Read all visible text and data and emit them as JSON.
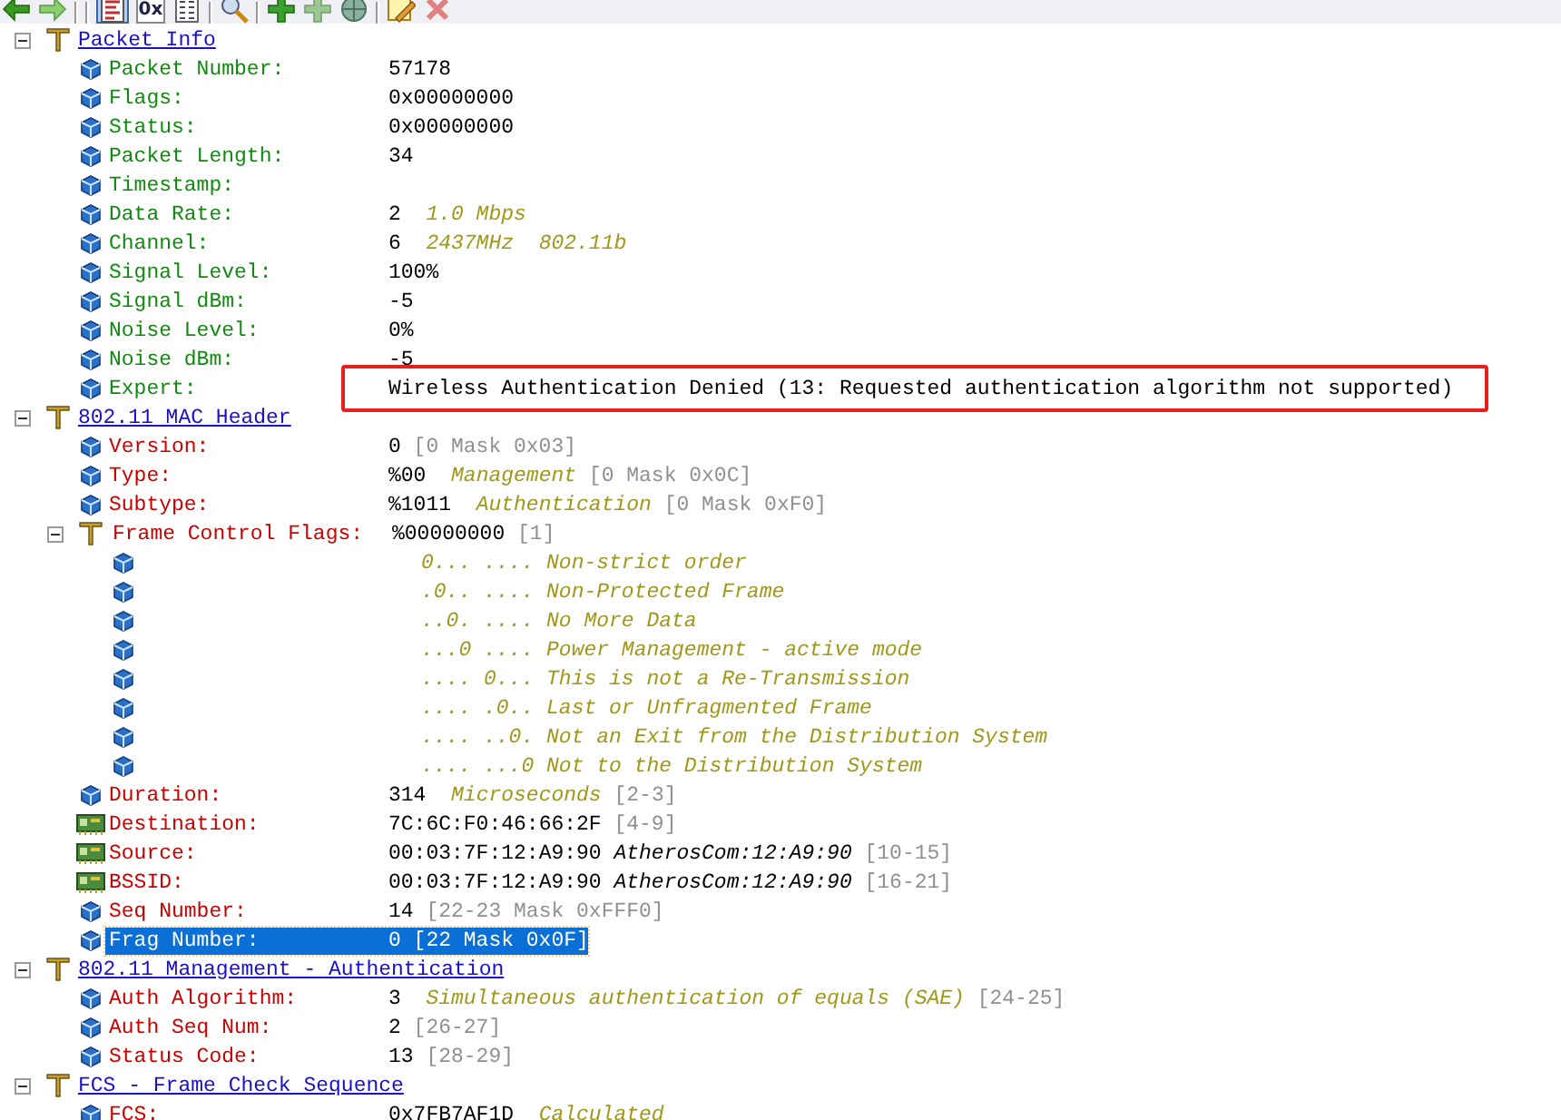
{
  "toolbar": [
    {
      "kind": "back"
    },
    {
      "kind": "forward"
    },
    {
      "kind": "separator"
    },
    {
      "kind": "separator"
    },
    {
      "kind": "decode-view",
      "selected": true
    },
    {
      "kind": "hex-view",
      "label": "0x",
      "selected": false
    },
    {
      "kind": "text-view",
      "selected": false
    },
    {
      "kind": "separator"
    },
    {
      "kind": "search"
    },
    {
      "kind": "separator"
    },
    {
      "kind": "add"
    },
    {
      "kind": "add-disabled"
    },
    {
      "kind": "globe"
    },
    {
      "kind": "separator"
    },
    {
      "kind": "edit"
    },
    {
      "kind": "delete"
    }
  ],
  "sections": [
    {
      "title": "Packet Info",
      "kind": "info",
      "expanded": true,
      "fields": [
        {
          "kind": "cube",
          "label": "Packet Number:",
          "value": "57178",
          "selected": false,
          "boxed": false
        },
        {
          "kind": "cube",
          "label": "Flags:",
          "value": "0x00000000",
          "selected": false,
          "boxed": false
        },
        {
          "kind": "cube",
          "label": "Status:",
          "value": "0x00000000",
          "selected": false,
          "boxed": false
        },
        {
          "kind": "cube",
          "label": "Packet Length:",
          "value": "34",
          "selected": false,
          "boxed": false
        },
        {
          "kind": "cube",
          "label": "Timestamp:",
          "selected": false,
          "boxed": false
        },
        {
          "kind": "cube",
          "label": "Data Rate:",
          "value": "2",
          "note": "1.0 Mbps",
          "selected": false,
          "boxed": false
        },
        {
          "kind": "cube",
          "label": "Channel:",
          "value": "6",
          "note": "2437MHz  802.11b",
          "selected": false,
          "boxed": false
        },
        {
          "kind": "cube",
          "label": "Signal Level:",
          "value": "100%",
          "selected": false,
          "boxed": false
        },
        {
          "kind": "cube",
          "label": "Signal dBm:",
          "value": "-5",
          "selected": false,
          "boxed": false
        },
        {
          "kind": "cube",
          "label": "Noise Level:",
          "value": "0%",
          "selected": false,
          "boxed": false
        },
        {
          "kind": "cube",
          "label": "Noise dBm:",
          "value": "-5",
          "selected": false,
          "boxed": false
        },
        {
          "kind": "cube",
          "label": "Expert:",
          "value": "Wireless Authentication Denied (13: Requested authentication algorithm not supported)",
          "selected": false,
          "boxed": true
        }
      ]
    },
    {
      "title": "802.11 MAC Header",
      "kind": "protocol",
      "expanded": true,
      "fields": [
        {
          "kind": "cube",
          "label": "Version:",
          "value": "0",
          "range": "[0 Mask 0x03]",
          "selected": false,
          "boxed": false
        },
        {
          "kind": "cube",
          "label": "Type:",
          "value": "%00",
          "note": "Management",
          "range": "[0 Mask 0x0C]",
          "selected": false,
          "boxed": false
        },
        {
          "kind": "cube",
          "label": "Subtype:",
          "value": "%1011",
          "note": "Authentication",
          "range": "[0 Mask 0xF0]",
          "selected": false,
          "boxed": false
        },
        {
          "kind": "branch",
          "label": "Frame Control Flags:",
          "value": "%00000000",
          "range": "[1]",
          "selected": false,
          "boxed": false,
          "expanded": true,
          "children": [
            {
              "kind": "cube",
              "note": "0... .... Non-strict order",
              "selected": false,
              "boxed": false
            },
            {
              "kind": "cube",
              "note": ".0.. .... Non-Protected Frame",
              "selected": false,
              "boxed": false
            },
            {
              "kind": "cube",
              "note": "..0. .... No More Data",
              "selected": false,
              "boxed": false
            },
            {
              "kind": "cube",
              "note": "...0 .... Power Management - active mode",
              "selected": false,
              "boxed": false
            },
            {
              "kind": "cube",
              "note": ".... 0... This is not a Re-Transmission",
              "selected": false,
              "boxed": false
            },
            {
              "kind": "cube",
              "note": ".... .0.. Last or Unfragmented Frame",
              "selected": false,
              "boxed": false
            },
            {
              "kind": "cube",
              "note": ".... ..0. Not an Exit from the Distribution System",
              "selected": false,
              "boxed": false
            },
            {
              "kind": "cube",
              "note": ".... ...0 Not to the Distribution System",
              "selected": false,
              "boxed": false
            }
          ]
        },
        {
          "kind": "cube",
          "label": "Duration:",
          "value": "314",
          "note": "Microseconds",
          "range": "[2-3]",
          "selected": false,
          "boxed": false
        },
        {
          "kind": "address",
          "label": "Destination:",
          "value": "7C:6C:F0:46:66:2F",
          "range": "[4-9]",
          "selected": false,
          "boxed": false
        },
        {
          "kind": "address",
          "label": "Source:",
          "value": "00:03:7F:12:A9:90",
          "vendor": "AtherosCom:12:A9:90",
          "range": "[10-15]",
          "selected": false,
          "boxed": false
        },
        {
          "kind": "address",
          "label": "BSSID:",
          "value": "00:03:7F:12:A9:90",
          "vendor": "AtherosCom:12:A9:90",
          "range": "[16-21]",
          "selected": false,
          "boxed": false
        },
        {
          "kind": "cube",
          "label": "Seq Number:",
          "value": "14",
          "range": "[22-23 Mask 0xFFF0]",
          "selected": false,
          "boxed": false
        },
        {
          "kind": "cube",
          "label": "Frag Number:",
          "value": "0",
          "range": "[22 Mask 0x0F]",
          "selected": true,
          "boxed": false
        }
      ]
    },
    {
      "title": "802.11 Management - Authentication",
      "kind": "protocol",
      "expanded": true,
      "fields": [
        {
          "kind": "cube",
          "label": "Auth Algorithm:",
          "value": "3",
          "note": "Simultaneous authentication of equals (SAE)",
          "range": "[24-25]",
          "selected": false,
          "boxed": false
        },
        {
          "kind": "cube",
          "label": "Auth Seq Num:",
          "value": "2",
          "range": "[26-27]",
          "selected": false,
          "boxed": false
        },
        {
          "kind": "cube",
          "label": "Status Code:",
          "value": "13",
          "range": "[28-29]",
          "selected": false,
          "boxed": false
        }
      ]
    },
    {
      "title": "FCS - Frame Check Sequence",
      "kind": "protocol",
      "expanded": true,
      "fields": [
        {
          "kind": "cube",
          "label": "FCS:",
          "value": "0x7FB7AF1D",
          "note": "Calculated",
          "selected": false,
          "boxed": false
        }
      ]
    }
  ]
}
